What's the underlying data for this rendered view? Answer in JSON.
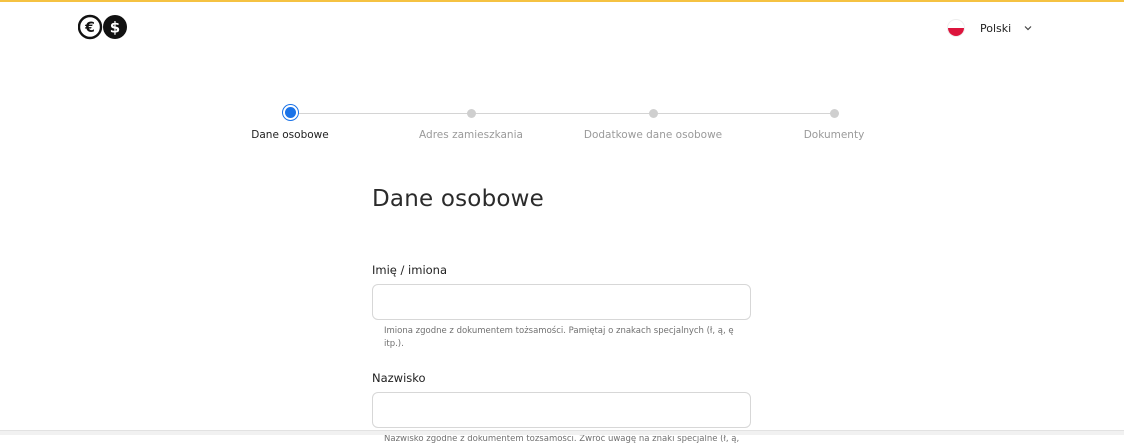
{
  "header": {
    "logo_icon": "euro-dollar-logo-icon",
    "language": {
      "label": "Polski",
      "flag_icon": "poland-flag-icon",
      "chevron_icon": "chevron-down-icon"
    }
  },
  "stepper": {
    "steps": [
      {
        "label": "Dane osobowe",
        "active": true
      },
      {
        "label": "Adres zamieszkania",
        "active": false
      },
      {
        "label": "Dodatkowe dane osobowe",
        "active": false
      },
      {
        "label": "Dokumenty",
        "active": false
      }
    ]
  },
  "form": {
    "title": "Dane osobowe",
    "fields": [
      {
        "label": "Imię / imiona",
        "value": "",
        "hint": "Imiona zgodne z dokumentem tożsamości. Pamiętaj o znakach specjalnych (ł, ą, ę itp.)."
      },
      {
        "label": "Nazwisko",
        "value": "",
        "hint": "Nazwisko zgodne z dokumentem tożsamości. Zwróć uwagę na znaki specjalne (ł, ą,"
      }
    ]
  },
  "colors": {
    "accent": "#1a73e8",
    "top_bar": "#f5c242",
    "inactive_step": "#cfcfcf"
  }
}
